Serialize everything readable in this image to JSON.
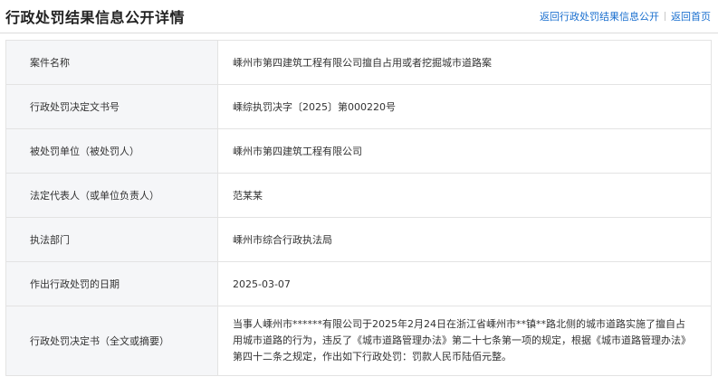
{
  "header": {
    "title": "行政处罚结果信息公开详情",
    "links": [
      {
        "label": "返回行政处罚结果信息公开"
      },
      {
        "label": "返回首页"
      }
    ]
  },
  "details": [
    {
      "label": "案件名称",
      "value": "嵊州市第四建筑工程有限公司擅自占用或者挖掘城市道路案"
    },
    {
      "label": "行政处罚决定文书号",
      "value": "嵊综执罚决字〔2025〕第000220号"
    },
    {
      "label": "被处罚单位（被处罚人）",
      "value": "嵊州市第四建筑工程有限公司"
    },
    {
      "label": "法定代表人（或单位负责人）",
      "value": "范某某"
    },
    {
      "label": "执法部门",
      "value": "嵊州市综合行政执法局"
    },
    {
      "label": "作出行政处罚的日期",
      "value": "2025-03-07"
    },
    {
      "label": "行政处罚决定书（全文或摘要）",
      "value": "当事人嵊州市******有限公司于2025年2月24日在浙江省嵊州市**镇**路北侧的城市道路实施了擅自占用城市道路的行为，违反了《城市道路管理办法》第二十七条第一项的规定，根据《城市道路管理办法》第四十二条之规定，作出如下行政处罚：罚款人民币陆佰元整。"
    }
  ]
}
